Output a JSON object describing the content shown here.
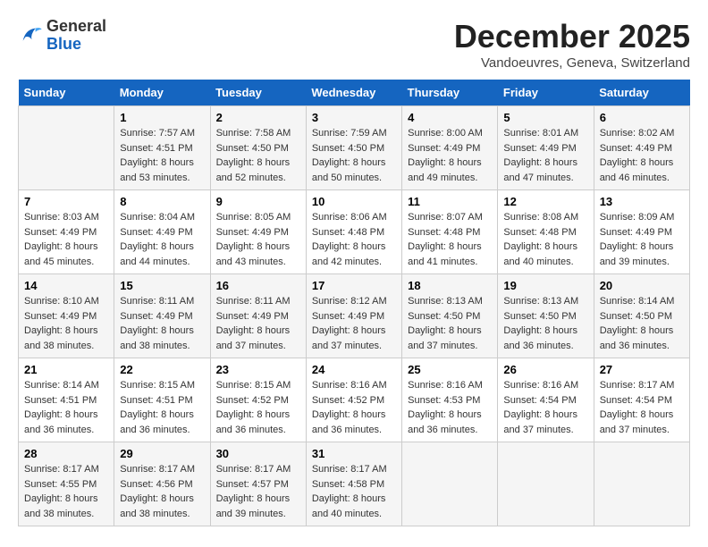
{
  "header": {
    "logo_line1": "General",
    "logo_line2": "Blue",
    "month": "December 2025",
    "location": "Vandoeuvres, Geneva, Switzerland"
  },
  "days_of_week": [
    "Sunday",
    "Monday",
    "Tuesday",
    "Wednesday",
    "Thursday",
    "Friday",
    "Saturday"
  ],
  "weeks": [
    [
      {
        "num": "",
        "sunrise": "",
        "sunset": "",
        "daylight": ""
      },
      {
        "num": "1",
        "sunrise": "Sunrise: 7:57 AM",
        "sunset": "Sunset: 4:51 PM",
        "daylight": "Daylight: 8 hours and 53 minutes."
      },
      {
        "num": "2",
        "sunrise": "Sunrise: 7:58 AM",
        "sunset": "Sunset: 4:50 PM",
        "daylight": "Daylight: 8 hours and 52 minutes."
      },
      {
        "num": "3",
        "sunrise": "Sunrise: 7:59 AM",
        "sunset": "Sunset: 4:50 PM",
        "daylight": "Daylight: 8 hours and 50 minutes."
      },
      {
        "num": "4",
        "sunrise": "Sunrise: 8:00 AM",
        "sunset": "Sunset: 4:49 PM",
        "daylight": "Daylight: 8 hours and 49 minutes."
      },
      {
        "num": "5",
        "sunrise": "Sunrise: 8:01 AM",
        "sunset": "Sunset: 4:49 PM",
        "daylight": "Daylight: 8 hours and 47 minutes."
      },
      {
        "num": "6",
        "sunrise": "Sunrise: 8:02 AM",
        "sunset": "Sunset: 4:49 PM",
        "daylight": "Daylight: 8 hours and 46 minutes."
      }
    ],
    [
      {
        "num": "7",
        "sunrise": "Sunrise: 8:03 AM",
        "sunset": "Sunset: 4:49 PM",
        "daylight": "Daylight: 8 hours and 45 minutes."
      },
      {
        "num": "8",
        "sunrise": "Sunrise: 8:04 AM",
        "sunset": "Sunset: 4:49 PM",
        "daylight": "Daylight: 8 hours and 44 minutes."
      },
      {
        "num": "9",
        "sunrise": "Sunrise: 8:05 AM",
        "sunset": "Sunset: 4:49 PM",
        "daylight": "Daylight: 8 hours and 43 minutes."
      },
      {
        "num": "10",
        "sunrise": "Sunrise: 8:06 AM",
        "sunset": "Sunset: 4:48 PM",
        "daylight": "Daylight: 8 hours and 42 minutes."
      },
      {
        "num": "11",
        "sunrise": "Sunrise: 8:07 AM",
        "sunset": "Sunset: 4:48 PM",
        "daylight": "Daylight: 8 hours and 41 minutes."
      },
      {
        "num": "12",
        "sunrise": "Sunrise: 8:08 AM",
        "sunset": "Sunset: 4:48 PM",
        "daylight": "Daylight: 8 hours and 40 minutes."
      },
      {
        "num": "13",
        "sunrise": "Sunrise: 8:09 AM",
        "sunset": "Sunset: 4:49 PM",
        "daylight": "Daylight: 8 hours and 39 minutes."
      }
    ],
    [
      {
        "num": "14",
        "sunrise": "Sunrise: 8:10 AM",
        "sunset": "Sunset: 4:49 PM",
        "daylight": "Daylight: 8 hours and 38 minutes."
      },
      {
        "num": "15",
        "sunrise": "Sunrise: 8:11 AM",
        "sunset": "Sunset: 4:49 PM",
        "daylight": "Daylight: 8 hours and 38 minutes."
      },
      {
        "num": "16",
        "sunrise": "Sunrise: 8:11 AM",
        "sunset": "Sunset: 4:49 PM",
        "daylight": "Daylight: 8 hours and 37 minutes."
      },
      {
        "num": "17",
        "sunrise": "Sunrise: 8:12 AM",
        "sunset": "Sunset: 4:49 PM",
        "daylight": "Daylight: 8 hours and 37 minutes."
      },
      {
        "num": "18",
        "sunrise": "Sunrise: 8:13 AM",
        "sunset": "Sunset: 4:50 PM",
        "daylight": "Daylight: 8 hours and 37 minutes."
      },
      {
        "num": "19",
        "sunrise": "Sunrise: 8:13 AM",
        "sunset": "Sunset: 4:50 PM",
        "daylight": "Daylight: 8 hours and 36 minutes."
      },
      {
        "num": "20",
        "sunrise": "Sunrise: 8:14 AM",
        "sunset": "Sunset: 4:50 PM",
        "daylight": "Daylight: 8 hours and 36 minutes."
      }
    ],
    [
      {
        "num": "21",
        "sunrise": "Sunrise: 8:14 AM",
        "sunset": "Sunset: 4:51 PM",
        "daylight": "Daylight: 8 hours and 36 minutes."
      },
      {
        "num": "22",
        "sunrise": "Sunrise: 8:15 AM",
        "sunset": "Sunset: 4:51 PM",
        "daylight": "Daylight: 8 hours and 36 minutes."
      },
      {
        "num": "23",
        "sunrise": "Sunrise: 8:15 AM",
        "sunset": "Sunset: 4:52 PM",
        "daylight": "Daylight: 8 hours and 36 minutes."
      },
      {
        "num": "24",
        "sunrise": "Sunrise: 8:16 AM",
        "sunset": "Sunset: 4:52 PM",
        "daylight": "Daylight: 8 hours and 36 minutes."
      },
      {
        "num": "25",
        "sunrise": "Sunrise: 8:16 AM",
        "sunset": "Sunset: 4:53 PM",
        "daylight": "Daylight: 8 hours and 36 minutes."
      },
      {
        "num": "26",
        "sunrise": "Sunrise: 8:16 AM",
        "sunset": "Sunset: 4:54 PM",
        "daylight": "Daylight: 8 hours and 37 minutes."
      },
      {
        "num": "27",
        "sunrise": "Sunrise: 8:17 AM",
        "sunset": "Sunset: 4:54 PM",
        "daylight": "Daylight: 8 hours and 37 minutes."
      }
    ],
    [
      {
        "num": "28",
        "sunrise": "Sunrise: 8:17 AM",
        "sunset": "Sunset: 4:55 PM",
        "daylight": "Daylight: 8 hours and 38 minutes."
      },
      {
        "num": "29",
        "sunrise": "Sunrise: 8:17 AM",
        "sunset": "Sunset: 4:56 PM",
        "daylight": "Daylight: 8 hours and 38 minutes."
      },
      {
        "num": "30",
        "sunrise": "Sunrise: 8:17 AM",
        "sunset": "Sunset: 4:57 PM",
        "daylight": "Daylight: 8 hours and 39 minutes."
      },
      {
        "num": "31",
        "sunrise": "Sunrise: 8:17 AM",
        "sunset": "Sunset: 4:58 PM",
        "daylight": "Daylight: 8 hours and 40 minutes."
      },
      {
        "num": "",
        "sunrise": "",
        "sunset": "",
        "daylight": ""
      },
      {
        "num": "",
        "sunrise": "",
        "sunset": "",
        "daylight": ""
      },
      {
        "num": "",
        "sunrise": "",
        "sunset": "",
        "daylight": ""
      }
    ]
  ]
}
